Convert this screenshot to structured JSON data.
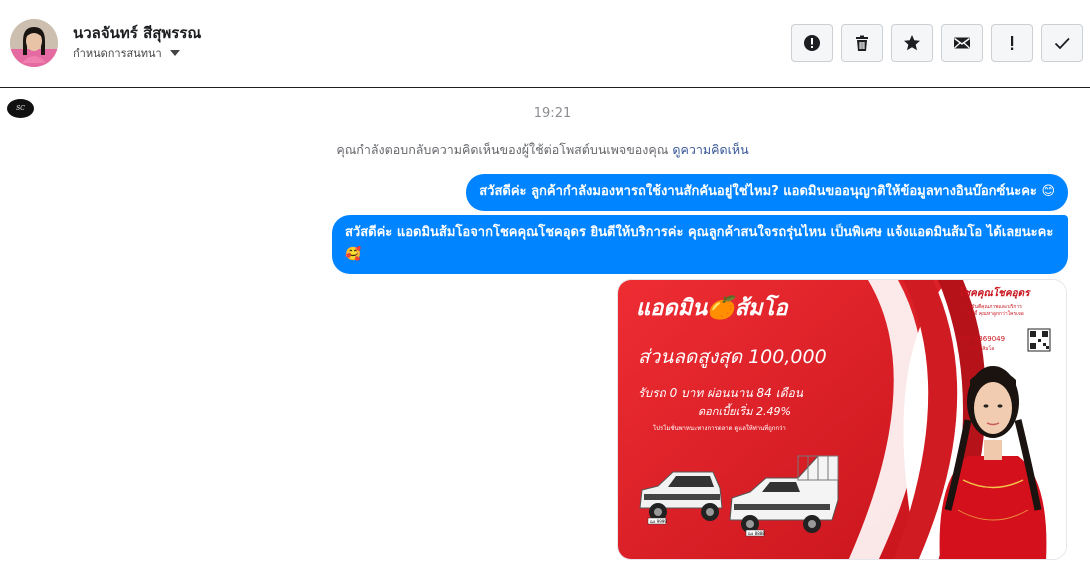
{
  "contact": {
    "name": "นวลจันทร์ สีสุพรรณ",
    "assign_label": "กำหนดการสนทนา"
  },
  "toolbar": {
    "buttons": [
      "report-icon",
      "trash-icon",
      "star-icon",
      "envelope-icon",
      "exclamation-icon",
      "check-icon"
    ]
  },
  "conversation": {
    "time": "19:21",
    "notice_text": "คุณกำลังตอบกลับความคิดเห็นของผู้ใช้ต่อโพสต์บนเพจของคุณ",
    "notice_link": "ดูความคิดเห็น",
    "messages": [
      {
        "text": "สวัสดีค่ะ ลูกค้ากำลังมองหารถใช้งานสักคันอยู่ใช่ไหม? แอดมินขออนุญาติให้ข้อมูลทางอินบ๊อกซ์นะคะ 😊"
      },
      {
        "text": "สวัสดีค่ะ แอดมินส้มโอจากโชคคุณโชคอุดร ยินดีให้บริการค่ะ   คุณลูกค้าสนใจรถรุ่นไหน เป็นพิเศษ แจ้งแอดมินส้มโอ ได้เลยนะคะ🥰"
      }
    ]
  },
  "promo": {
    "title": "แอดมิน🍊ส้มโอ",
    "discount": "ส่วนลดสูงสุด 100,000",
    "installment": "รับรถ 0 บาท ผ่อนนาน 84 เดือน",
    "interest": "ดอกเบี้ยเริ่ม 2.49%",
    "fineprint": "โปรโมชั่นพาหนะทางการตลาด ดูแลให้ท่านที่ถูกกว่า",
    "shop_name": "โชคคุณโชคอุดร",
    "shop_sub1": "การันตีคุณภาพและบริการ",
    "shop_sub2": "ออดี้ คุณหาลูกกว่าใครเจอ",
    "phone": "062-9369049",
    "line_label": "แอดมินส้มโอ",
    "plate1": "ฌง 9999",
    "plate2": "ฌง 8888"
  },
  "colors": {
    "bubble": "#0084ff",
    "promo_red": "#e3232a",
    "link": "#385898"
  }
}
